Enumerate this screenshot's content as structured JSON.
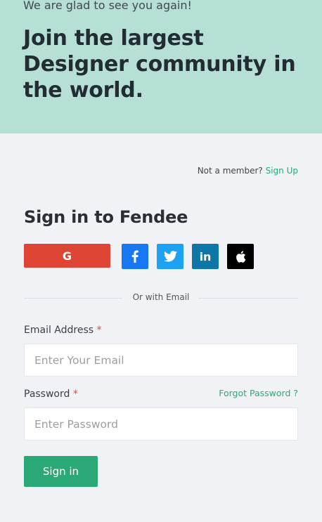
{
  "colors": {
    "hero_bg": "#b6dfd5",
    "page_bg": "#f1f2f6",
    "accent": "#2aa876",
    "google": "#df4534",
    "facebook": "#1877f2",
    "twitter": "#1da1f2",
    "linkedin": "#0e76a8",
    "apple": "#000000",
    "required": "#e44a3a"
  },
  "hero": {
    "greeting": "We are glad to see you again!",
    "title": "Join the largest Designer community in the world."
  },
  "header": {
    "member_prompt": "Not a member?",
    "signup_label": "Sign Up"
  },
  "form": {
    "title": "Sign in to Fendee",
    "divider_text": "Or with Email",
    "email": {
      "label": "Email Address",
      "required_mark": "*",
      "placeholder": "Enter Your Email",
      "value": ""
    },
    "password": {
      "label": "Password",
      "required_mark": "*",
      "placeholder": "Enter Password",
      "value": "",
      "forgot_label": "Forgot Password ?"
    },
    "submit_label": "Sign in"
  },
  "social": {
    "google_icon": "G",
    "facebook_icon": "facebook-icon",
    "twitter_icon": "twitter-icon",
    "linkedin_icon": "in",
    "apple_icon": "apple-icon"
  }
}
